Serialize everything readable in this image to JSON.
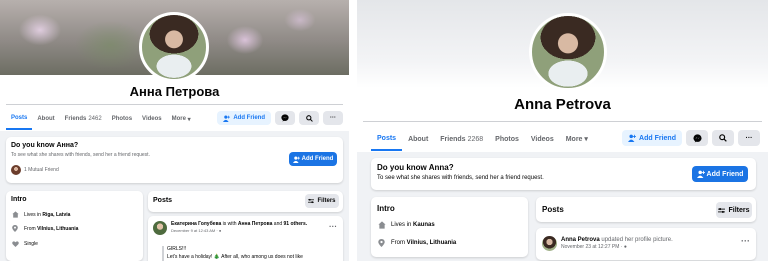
{
  "left": {
    "profile_name": "Анна Петрова",
    "tabs": [
      {
        "label": "Posts",
        "active": true
      },
      {
        "label": "About"
      },
      {
        "label": "Friends",
        "count": "2462"
      },
      {
        "label": "Photos"
      },
      {
        "label": "Videos"
      },
      {
        "label": "More",
        "dropdown": true
      }
    ],
    "add_friend_label": "Add Friend",
    "know_card": {
      "title": "Do you know Анна?",
      "subtitle": "To see what she shares with friends, send her a friend request.",
      "button_label": "Add Friend",
      "mutual_friends": "1 Mutual Friend"
    },
    "intro": {
      "title": "Intro",
      "rows": [
        {
          "icon": "home-icon",
          "prefix": "Lives in",
          "value": "Riga, Latvia"
        },
        {
          "icon": "location-pin-icon",
          "prefix": "From",
          "value": "Vilnius, Lithuania"
        },
        {
          "icon": "heart-icon",
          "prefix": "",
          "value": "Single"
        }
      ]
    },
    "posts": {
      "title": "Posts",
      "filters_label": "Filters",
      "post": {
        "author": "Екатерина Голубева",
        "action": "is with",
        "tagged": "Анна Петрова",
        "and": "and",
        "others": "91 others.",
        "time": "December 9 at 12:43 AM",
        "body_line1": "GIRLS!!!",
        "body_line2": "Let's have a holiday! 🎄 After all, who among us does not like"
      }
    }
  },
  "right": {
    "profile_name": "Anna Petrova",
    "tabs": [
      {
        "label": "Posts",
        "active": true
      },
      {
        "label": "About"
      },
      {
        "label": "Friends",
        "count": "2268"
      },
      {
        "label": "Photos"
      },
      {
        "label": "Videos"
      },
      {
        "label": "More",
        "dropdown": true
      }
    ],
    "add_friend_label": "Add Friend",
    "know_card": {
      "title": "Do you know Anna?",
      "subtitle": "To see what she shares with friends, send her a friend request.",
      "button_label": "Add Friend"
    },
    "intro": {
      "title": "Intro",
      "rows": [
        {
          "icon": "home-icon",
          "prefix": "Lives in",
          "value": "Kaunas"
        },
        {
          "icon": "location-pin-icon",
          "prefix": "From",
          "value": "Vilnius, Lithuania"
        }
      ]
    },
    "posts": {
      "title": "Posts",
      "filters_label": "Filters",
      "post": {
        "author": "Anna Petrova",
        "action": "updated her profile picture.",
        "time": "November 23 at 12:27 PM"
      }
    }
  },
  "colors": {
    "accent": "#1877f2",
    "button_blue": "#1b74e4",
    "background": "#f0f2f5"
  }
}
